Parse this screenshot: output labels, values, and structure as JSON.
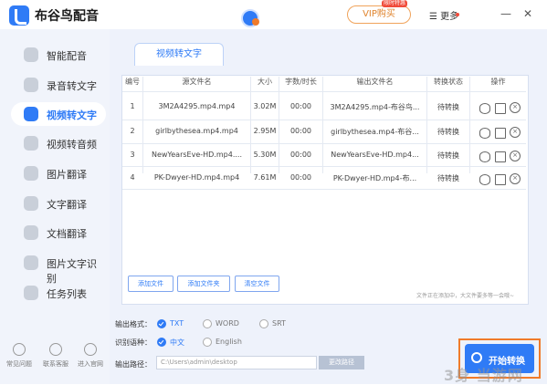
{
  "app": {
    "title": "布谷鸟配音"
  },
  "header": {
    "vip_label": "VIP购买",
    "vip_tag": "限时特惠",
    "more_label": "更多",
    "minimize": "—",
    "close": "✕"
  },
  "sidebar": {
    "items": [
      {
        "label": "智能配音",
        "icon": "mic-icon"
      },
      {
        "label": "录音转文字",
        "icon": "record-icon"
      },
      {
        "label": "视频转文字",
        "icon": "video-text-icon",
        "active": true
      },
      {
        "label": "视频转音频",
        "icon": "video-audio-icon"
      },
      {
        "label": "图片翻译",
        "icon": "image-translate-icon"
      },
      {
        "label": "文字翻译",
        "icon": "text-translate-icon"
      },
      {
        "label": "文档翻译",
        "icon": "doc-translate-icon"
      },
      {
        "label": "图片文字识别",
        "icon": "ocr-icon"
      },
      {
        "label": "任务列表",
        "icon": "task-list-icon"
      }
    ],
    "footer": [
      {
        "label": "常见问题",
        "icon": "help-icon"
      },
      {
        "label": "联系客服",
        "icon": "support-icon"
      },
      {
        "label": "进入官网",
        "icon": "website-icon"
      }
    ]
  },
  "main": {
    "tab": "视频转文字",
    "columns": [
      "编号",
      "源文件名",
      "大小",
      "字数/时长",
      "输出文件名",
      "转换状态",
      "操作"
    ],
    "rows": [
      {
        "no": "1",
        "source": "3M2A4295.mp4.mp4",
        "size": "3.02M",
        "duration": "00:00",
        "output": "3M2A4295.mp4-布谷鸟...",
        "status": "待转换"
      },
      {
        "no": "2",
        "source": "girlbythesea.mp4.mp4",
        "size": "2.95M",
        "duration": "00:00",
        "output": "girlbythesea.mp4-布谷...",
        "status": "待转换"
      },
      {
        "no": "3",
        "source": "NewYearsEve-HD.mp4....",
        "size": "5.30M",
        "duration": "00:00",
        "output": "NewYearsEve-HD.mp4...",
        "status": "待转换"
      },
      {
        "no": "4",
        "source": "PK-Dwyer-HD.mp4.mp4",
        "size": "7.61M",
        "duration": "00:00",
        "output": "PK-Dwyer-HD.mp4-布...",
        "status": "待转换"
      }
    ],
    "buttons": {
      "add_file": "添加文件",
      "add_folder": "添加文件夹",
      "clear": "清空文件"
    },
    "status_note": "文件正在添加中，大文件要多等一会哦~"
  },
  "options": {
    "format_label": "输出格式：",
    "formats": [
      {
        "label": "TXT",
        "selected": true
      },
      {
        "label": "WORD",
        "selected": false
      },
      {
        "label": "SRT",
        "selected": false
      }
    ],
    "lang_label": "识别语种：",
    "languages": [
      {
        "label": "中文",
        "selected": true
      },
      {
        "label": "English",
        "selected": false
      }
    ],
    "path_label": "输出路径：",
    "path_value": "C:\\Users\\admin\\desktop",
    "change_path": "更改路径",
    "start": "开始转换"
  },
  "watermark": "3身 当游网",
  "colors": {
    "accent": "#2f7bf6",
    "highlight": "#f07b2a",
    "sidebar_bg": "#f1f4fb"
  }
}
